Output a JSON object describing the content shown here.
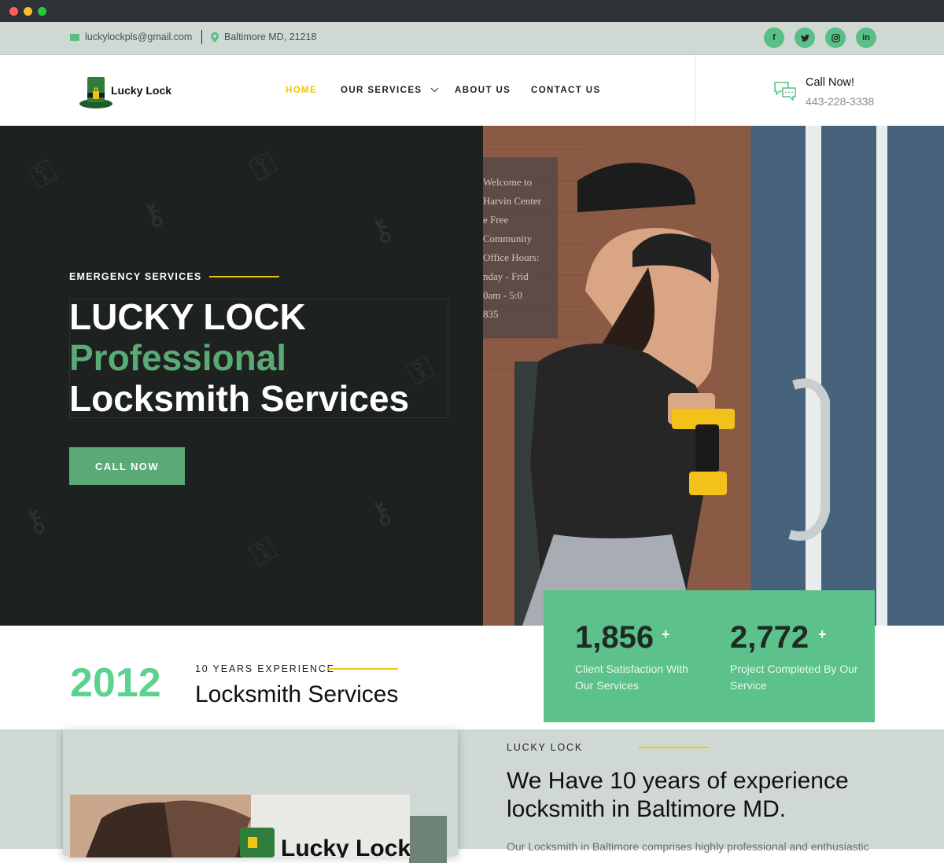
{
  "browser": {
    "dot_colors": [
      "#ff5f57",
      "#febc2e",
      "#28c840"
    ]
  },
  "topbar": {
    "email": "luckylockpls@gmail.com",
    "location": "Baltimore MD, 21218",
    "social": [
      {
        "icon": "facebook-icon",
        "glyph": "f"
      },
      {
        "icon": "twitter-icon",
        "glyph": "t"
      },
      {
        "icon": "instagram-icon",
        "glyph": "◎"
      },
      {
        "icon": "linkedin-icon",
        "glyph": "in"
      }
    ]
  },
  "header": {
    "logo_text": "Lucky Lock",
    "nav": [
      {
        "label": "HOME",
        "active": true
      },
      {
        "label": "OUR SERVICES",
        "dropdown": true
      },
      {
        "label": "ABOUT US"
      },
      {
        "label": "CONTACT US"
      }
    ],
    "call_label": "Call Now!",
    "phone": "443-228-3338"
  },
  "hero": {
    "eyebrow": "EMERGENCY SERVICES",
    "title_line1": "LUCKY LOCK",
    "title_line2": "Professional",
    "title_line3": "Locksmith Services",
    "cta": "CALL NOW",
    "photo_sign_text": [
      "Welcome to",
      "Harvin Center",
      "e Free Community",
      "Office Hours:",
      "nday - Frid",
      "0am - 5:0",
      "835"
    ]
  },
  "stats": [
    {
      "value": "1,856",
      "suffix": "+",
      "label": "Client Satisfaction With Our Services"
    },
    {
      "value": "2,772",
      "suffix": "+",
      "label": "Project Completed By Our Service"
    }
  ],
  "experience": {
    "year": "2012",
    "label": "10 YEARS EXPERIENCE",
    "title": "Locksmith Services"
  },
  "about": {
    "eyebrow": "LUCKY LOCK",
    "title": "We Have 10 years of experience locksmith in Baltimore MD.",
    "body": "Our Locksmith in Baltimore comprises highly professional and enthusiastic"
  },
  "colors": {
    "accent_green": "#5cc18a",
    "text_green": "#5aaa76",
    "year_green": "#5dd28e",
    "accent_yellow": "#f1c40f",
    "nav_active": "#f1c40f"
  }
}
